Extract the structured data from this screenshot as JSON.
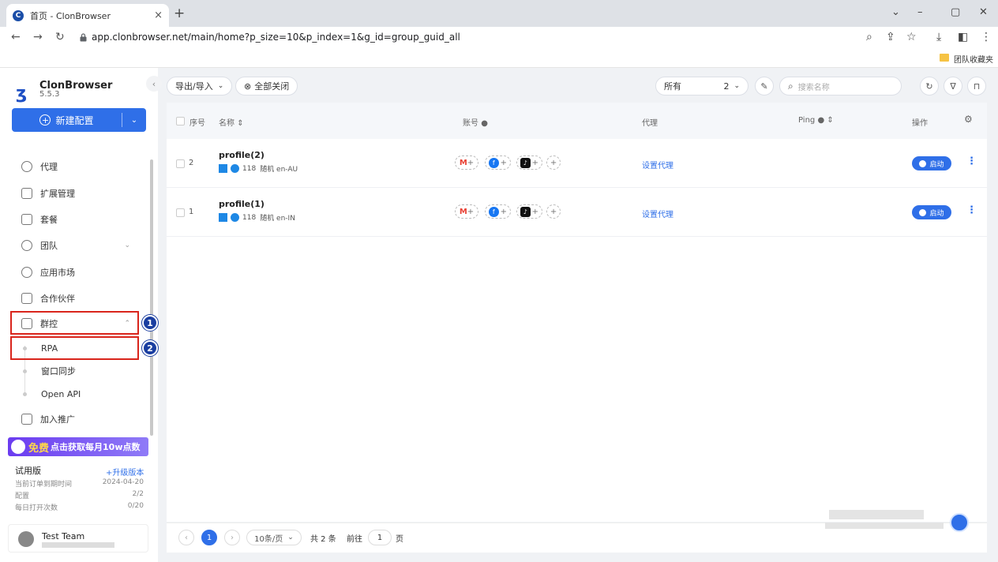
{
  "browser": {
    "tab_title": "首页 - ClonBrowser",
    "tab_close": "×",
    "new_tab": "+",
    "url": "app.clonbrowser.net/main/home?p_size=10&p_index=1&g_id=group_guid_all",
    "bookmark": "团队收藏夹"
  },
  "sidebar": {
    "brand": "ClonBrowser",
    "version": "5.5.3",
    "new_config": "新建配置",
    "items": [
      {
        "label": "代理"
      },
      {
        "label": "扩展管理"
      },
      {
        "label": "套餐"
      },
      {
        "label": "团队"
      },
      {
        "label": "应用市场"
      },
      {
        "label": "合作伙伴"
      },
      {
        "label": "群控"
      },
      {
        "label": "加入推广"
      }
    ],
    "sub_items": [
      {
        "label": "RPA"
      },
      {
        "label": "窗口同步"
      },
      {
        "label": "Open API"
      }
    ],
    "callouts": [
      "1",
      "2"
    ],
    "promo": {
      "free": "免费",
      "text": "点击获取每月10w点数"
    },
    "plan": {
      "name": "试用版",
      "upgrade": "+升级版本",
      "rows": [
        {
          "label": "当前订单到期时间",
          "value": "2024-04-20"
        },
        {
          "label": "配置",
          "value": "2/2"
        },
        {
          "label": "每日打开次数",
          "value": "0/20"
        }
      ]
    },
    "team": {
      "name": "Test Team"
    }
  },
  "toolbar": {
    "export_import": "导出/导入",
    "close_all": "全部关闭",
    "filter_all": "所有",
    "count": "2",
    "search_placeholder": "搜索名称"
  },
  "table": {
    "headers": {
      "index": "序号",
      "name": "名称",
      "account": "账号",
      "proxy": "代理",
      "ping": "Ping",
      "action": "操作"
    },
    "rows": [
      {
        "index": "2",
        "name": "profile(2)",
        "version": "118",
        "meta": "随机 en-AU",
        "proxy": "设置代理",
        "launch": "启动"
      },
      {
        "index": "1",
        "name": "profile(1)",
        "version": "118",
        "meta": "随机 en-IN",
        "proxy": "设置代理",
        "launch": "启动"
      }
    ]
  },
  "pager": {
    "current": "1",
    "page_size": "10条/页",
    "total": "共 2 条",
    "goto": "前往",
    "goto_value": "1",
    "page_suffix": "页"
  }
}
